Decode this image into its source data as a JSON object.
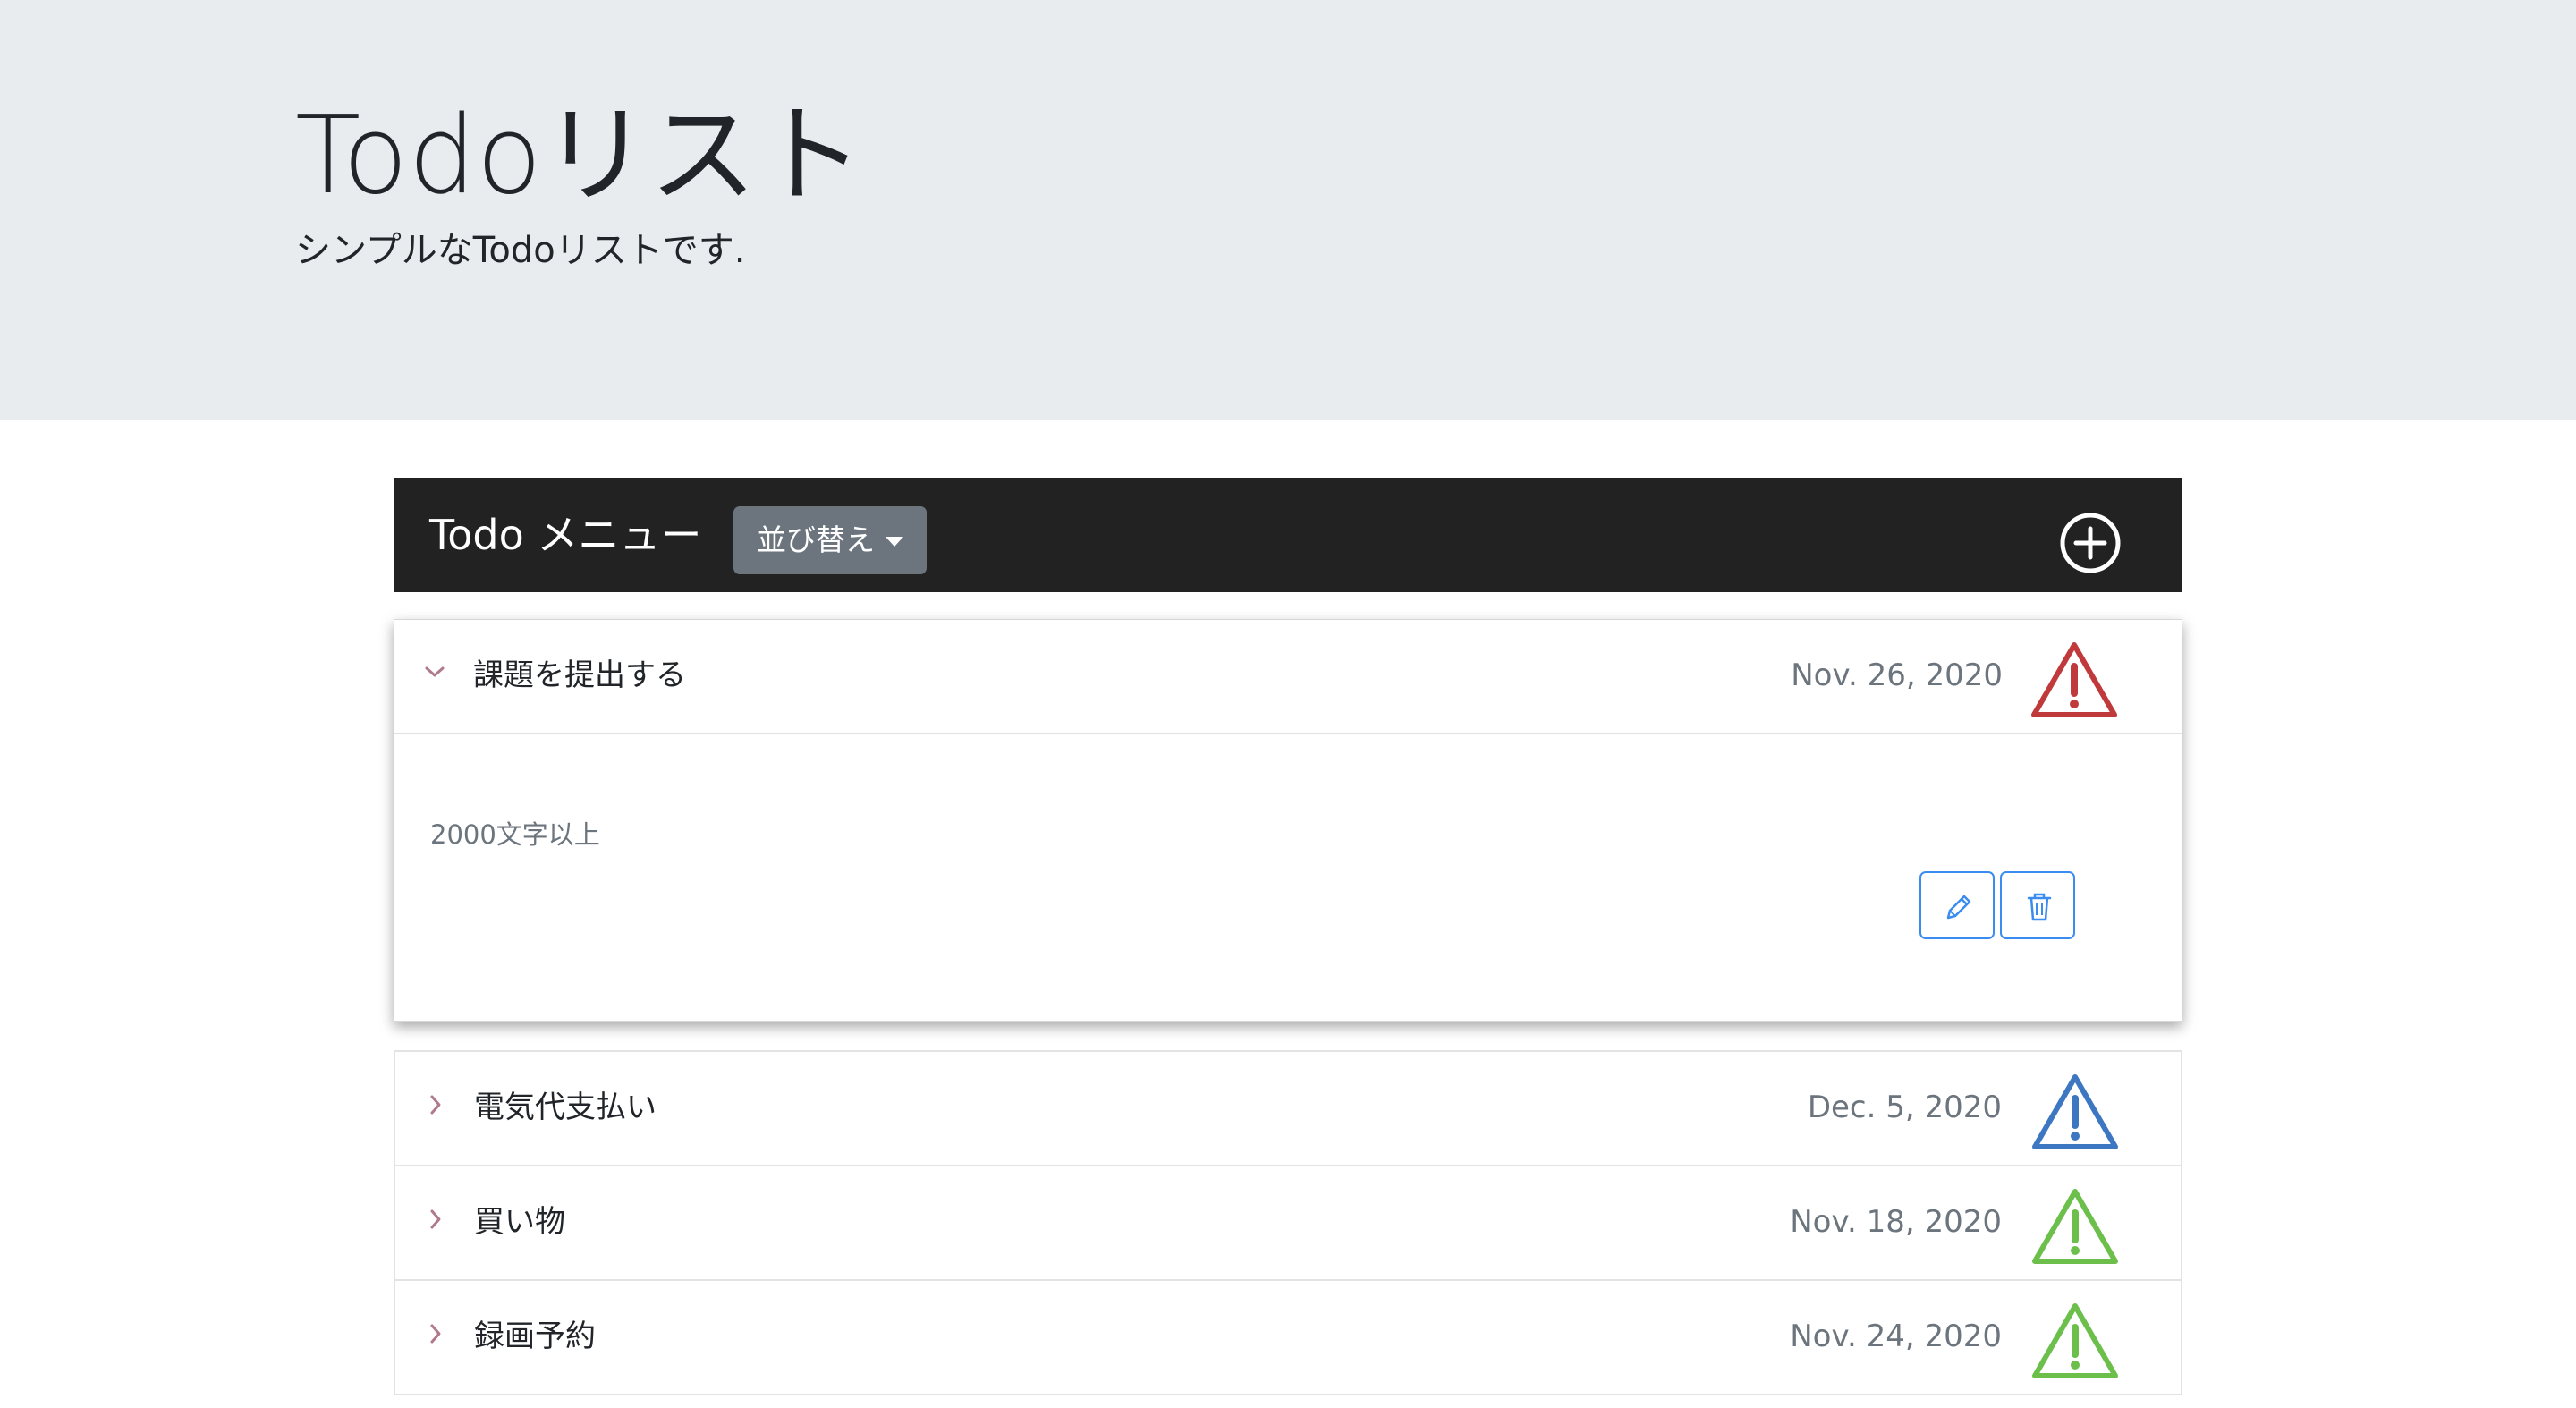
{
  "header": {
    "title": "Todoリスト",
    "lead": "シンプルなTodoリストです."
  },
  "menu": {
    "title": "Todo メニュー",
    "sort_label": "並び替え",
    "add_icon": "plus-circle-icon"
  },
  "todos": [
    {
      "title": "課題を提出する",
      "date": "Nov. 26, 2020",
      "priority_color": "#c0393b",
      "expanded": true,
      "description": "2000文字以上"
    },
    {
      "title": "電気代支払い",
      "date": "Dec. 5, 2020",
      "priority_color": "#3d77c2",
      "expanded": false
    },
    {
      "title": "買い物",
      "date": "Nov. 18, 2020",
      "priority_color": "#6cbf4a",
      "expanded": false
    },
    {
      "title": "録画予約",
      "date": "Nov. 24, 2020",
      "priority_color": "#6cbf4a",
      "expanded": false
    }
  ],
  "colors": {
    "jumbotron": "#e9ecef",
    "menubar": "#222222",
    "sort_button": "#6c757d",
    "action_button": "#3b8cf0",
    "chevron": "#b07a8a"
  }
}
